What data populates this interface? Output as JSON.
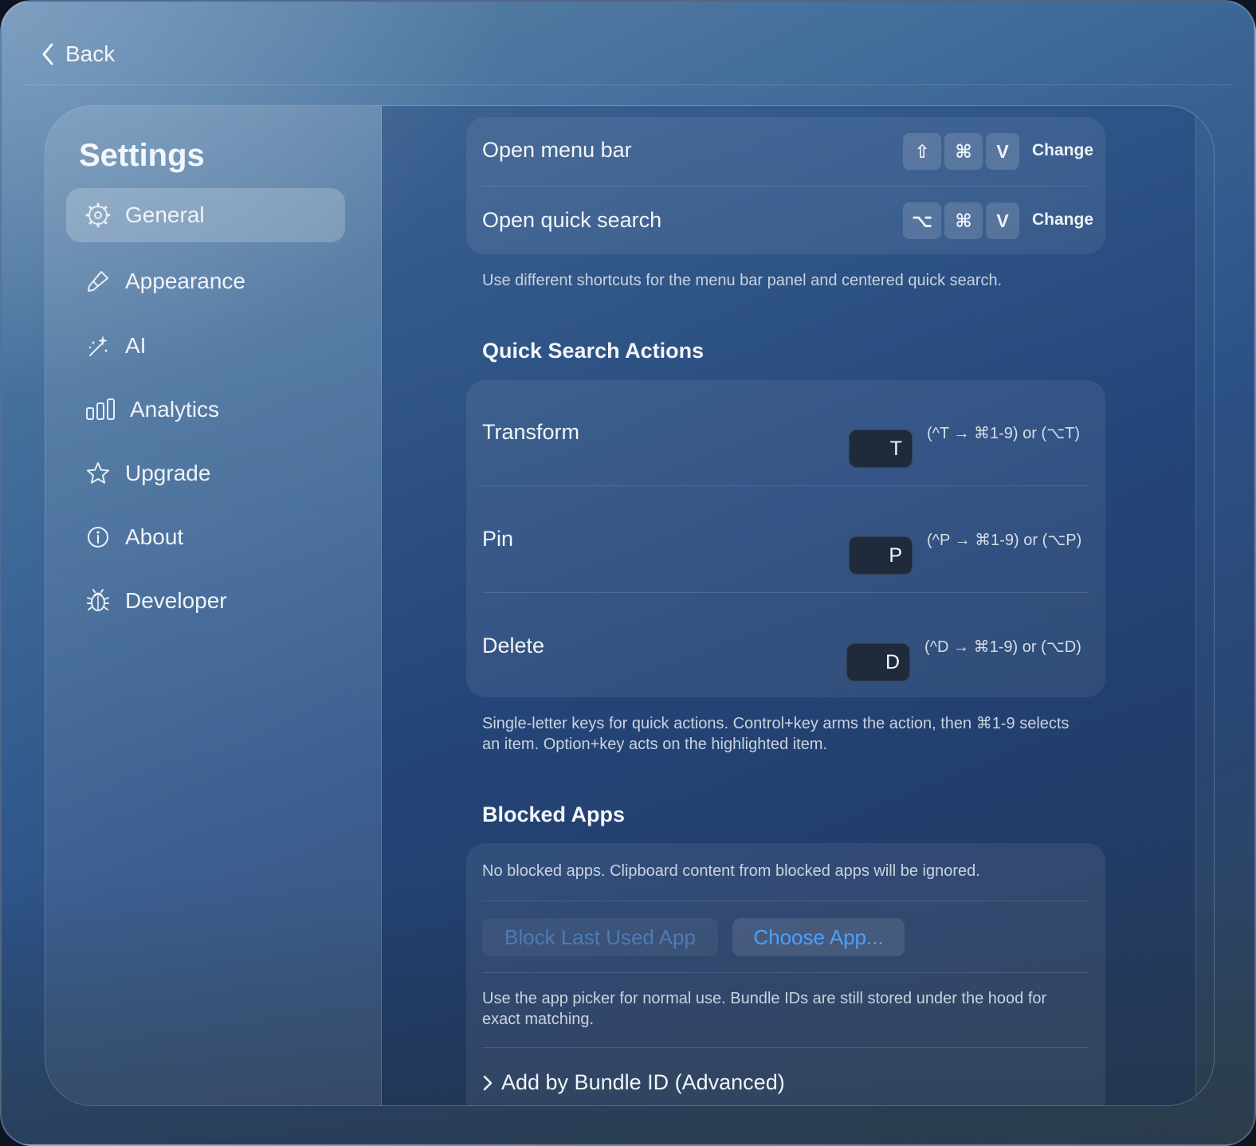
{
  "header": {
    "back_label": "Back"
  },
  "sidebar": {
    "title": "Settings",
    "items": [
      {
        "label": "General",
        "icon": "gear-icon",
        "active": true
      },
      {
        "label": "Appearance",
        "icon": "paintbrush-icon",
        "active": false
      },
      {
        "label": "AI",
        "icon": "sparkles-wand-icon",
        "active": false
      },
      {
        "label": "Analytics",
        "icon": "bar-chart-icon",
        "active": false
      },
      {
        "label": "Upgrade",
        "icon": "star-icon",
        "active": false
      },
      {
        "label": "About",
        "icon": "info-icon",
        "active": false
      },
      {
        "label": "Developer",
        "icon": "bug-icon",
        "active": false
      }
    ]
  },
  "shortcuts": {
    "rows": [
      {
        "label": "Open menu bar",
        "keys": [
          "⇧",
          "⌘",
          "V"
        ],
        "change_label": "Change"
      },
      {
        "label": "Open quick search",
        "keys": [
          "⌥",
          "⌘",
          "V"
        ],
        "change_label": "Change"
      }
    ],
    "note": "Use different shortcuts for the menu bar panel and centered quick search."
  },
  "quick_actions": {
    "title": "Quick Search Actions",
    "rows": [
      {
        "label": "Transform",
        "key": "T",
        "hint": "(^T → ⌘1-9) or (⌥T)"
      },
      {
        "label": "Pin",
        "key": "P",
        "hint": "(^P → ⌘1-9) or (⌥P)"
      },
      {
        "label": "Delete",
        "key": "D",
        "hint": "(^D → ⌘1-9) or (⌥D)"
      }
    ],
    "note": "Single-letter keys for quick actions. Control+key arms the action, then ⌘1-9 selects an item. Option+key acts on the highlighted item."
  },
  "blocked_apps": {
    "title": "Blocked Apps",
    "empty_text": "No blocked apps. Clipboard content from blocked apps will be ignored.",
    "block_last_label": "Block Last Used App",
    "choose_app_label": "Choose App...",
    "note": "Use the app picker for normal use. Bundle IDs are still stored under the hood for exact matching.",
    "advanced_label": "Add by Bundle ID (Advanced)"
  },
  "colors": {
    "accent": "#4aa0ff",
    "disabled_text": "#4e7ab5"
  }
}
